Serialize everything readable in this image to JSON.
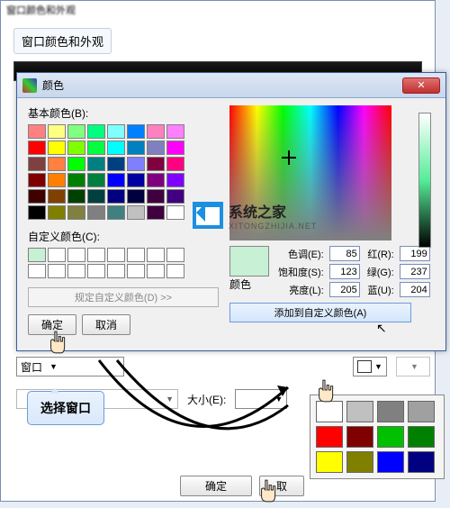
{
  "outer": {
    "title_blurred": "窗口颜色和外观",
    "header": "窗口颜色和外观"
  },
  "dialog": {
    "title": "颜色",
    "close": "✕",
    "basic_label": "基本颜色(B):",
    "custom_label": "自定义颜色(C):",
    "define_btn": "规定自定义颜色(D) >>",
    "ok": "确定",
    "cancel": "取消",
    "preview_label": "颜色",
    "hue_label": "色调(E):",
    "hue_val": "85",
    "sat_label": "饱和度(S):",
    "sat_val": "123",
    "lum_label": "亮度(L):",
    "lum_val": "205",
    "red_label": "红(R):",
    "red_val": "199",
    "green_label": "绿(G):",
    "green_val": "237",
    "blue_label": "蓝(U):",
    "blue_val": "204",
    "add_btn": "添加到自定义颜色(A)",
    "basic_colors": [
      "#ff8080",
      "#ffff80",
      "#80ff80",
      "#00ff80",
      "#80ffff",
      "#0080ff",
      "#ff80c0",
      "#ff80ff",
      "#ff0000",
      "#ffff00",
      "#80ff00",
      "#00ff40",
      "#00ffff",
      "#0080c0",
      "#8080c0",
      "#ff00ff",
      "#804040",
      "#ff8040",
      "#00ff00",
      "#008080",
      "#004080",
      "#8080ff",
      "#800040",
      "#ff0080",
      "#800000",
      "#ff8000",
      "#008000",
      "#008040",
      "#0000ff",
      "#0000a0",
      "#800080",
      "#8000ff",
      "#400000",
      "#804000",
      "#004000",
      "#004040",
      "#000080",
      "#000040",
      "#400040",
      "#400080",
      "#000000",
      "#808000",
      "#808040",
      "#808080",
      "#408080",
      "#c0c0c0",
      "#400040",
      "#ffffff"
    ]
  },
  "bottom": {
    "item_combo": "窗口",
    "size_label": "大小(E):",
    "ok": "确定",
    "cancel": "取"
  },
  "annotation": {
    "text": "选择窗口"
  },
  "palette": [
    "#ffffff",
    "#c0c0c0",
    "#808080",
    "#a0a0a0",
    "#ff0000",
    "#800000",
    "#00c000",
    "#008000",
    "#ffff00",
    "#808000",
    "#0000ff",
    "#000080"
  ],
  "watermark": {
    "name": "系统之家",
    "url": "XITONGZHIJIA.NET"
  }
}
